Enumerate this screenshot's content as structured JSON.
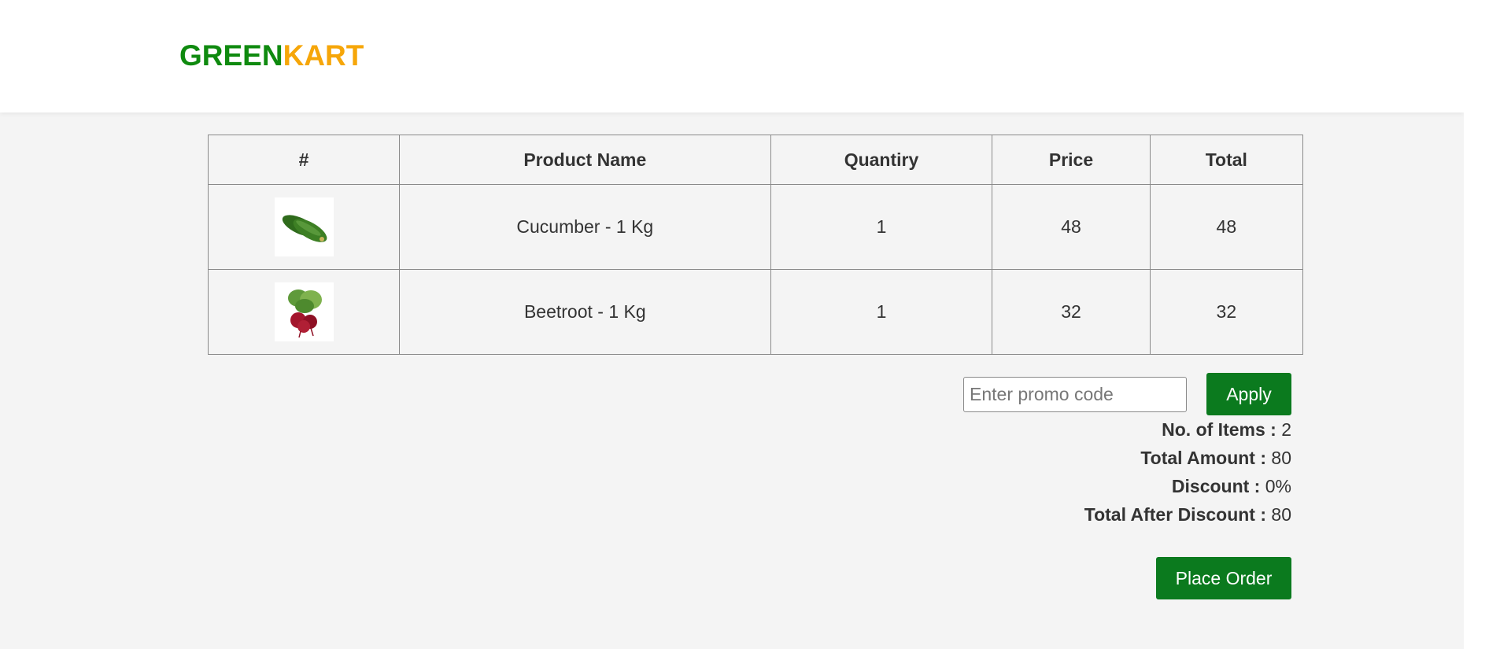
{
  "brand": {
    "part1": "GREEN",
    "part2": "KART",
    "colors": {
      "green": "#0f8a0f",
      "orange": "#f6a609"
    }
  },
  "table": {
    "headers": [
      "#",
      "Product Name",
      "Quantiry",
      "Price",
      "Total"
    ],
    "rows": [
      {
        "image": "cucumber-image",
        "name": "Cucumber - 1 Kg",
        "quantity": "1",
        "price": "48",
        "total": "48"
      },
      {
        "image": "beetroot-image",
        "name": "Beetroot - 1 Kg",
        "quantity": "1",
        "price": "32",
        "total": "32"
      }
    ]
  },
  "promo": {
    "placeholder": "Enter promo code",
    "value": "",
    "apply_label": "Apply"
  },
  "summary": {
    "items_label": "No. of Items :",
    "items_value": "2",
    "amount_label": "Total Amount :",
    "amount_value": "80",
    "discount_label": "Discount :",
    "discount_value": "0%",
    "after_label": "Total After Discount :",
    "after_value": "80"
  },
  "place_order_label": "Place Order",
  "accent_color": "#0b7a1e"
}
